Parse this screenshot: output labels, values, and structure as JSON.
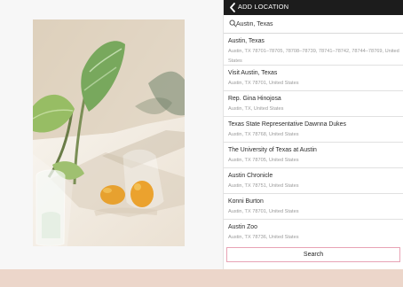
{
  "header": {
    "title": "ADD LOCATION"
  },
  "search": {
    "value": "Austin, Texas",
    "button_label": "Search"
  },
  "results": [
    {
      "title": "Austin, Texas",
      "subtitle": "Austin, TX 78701–78705, 78708–78739, 78741–78742, 78744–78769, United States"
    },
    {
      "title": "Visit Austin, Texas",
      "subtitle": "Austin, TX 78701, United States"
    },
    {
      "title": "Rep. Gina Hinojosa",
      "subtitle": "Austin, TX, United States"
    },
    {
      "title": "Texas State Representative Dawnna Dukes",
      "subtitle": "Austin, TX 78768, United States"
    },
    {
      "title": "The University of Texas at Austin",
      "subtitle": "Austin, TX 78705, United States"
    },
    {
      "title": "Austin Chronicle",
      "subtitle": "Austin, TX 78751, United States"
    },
    {
      "title": "Konni Burton",
      "subtitle": "Austin, TX 78701, United States"
    },
    {
      "title": "Austin Zoo",
      "subtitle": "Austin, TX 78736, United States"
    }
  ],
  "colors": {
    "header_bg": "#1c1c1c",
    "bottom_strip": "#ecd6ca",
    "button_border": "#e8a3b5"
  },
  "icons": {
    "back": "chevron-left-icon",
    "search": "search-icon"
  }
}
